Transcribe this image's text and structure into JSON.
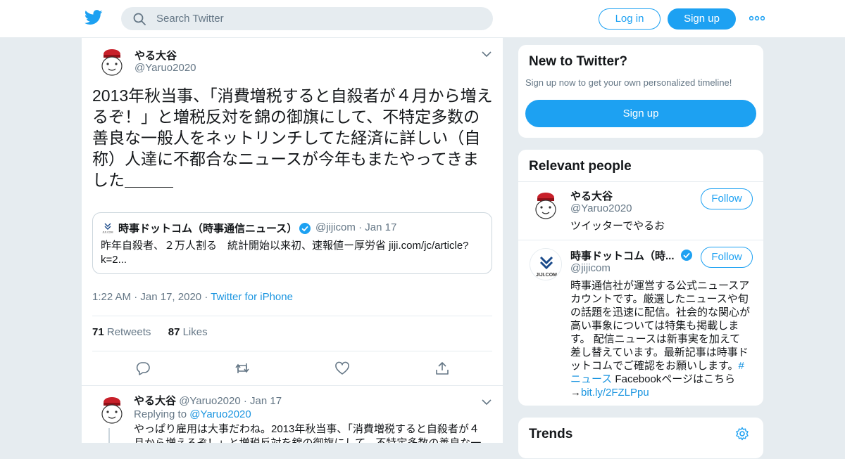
{
  "header": {
    "search_placeholder": "Search Twitter",
    "login_label": "Log in",
    "signup_label": "Sign up"
  },
  "tweet": {
    "author_name": "やる大谷",
    "author_handle": "@Yaruo2020",
    "text": "2013年秋当事、「消費増税すると自殺者が４月から増えるぞ！」と増税反対を錦の御旗にして、不特定多数の善良な一般人をネットリンチしてた経済に詳しい（自称）人達に不都合なニュースが今年もまたやってきました＿＿＿",
    "quote": {
      "avatar_text": "JIJI.COM",
      "name": "時事ドットコム（時事通信ニュース）",
      "handle": "@jijicom",
      "date": "Jan 17",
      "text": "昨年自殺者、２万人割る　統計開始以来初、速報値ー厚労省 jiji.com/jc/article?k=2..."
    },
    "time": "1:22 AM",
    "date": "Jan 17, 2020",
    "source": "Twitter for iPhone",
    "retweets_count": "71",
    "retweets_label": "Retweets",
    "likes_count": "87",
    "likes_label": "Likes"
  },
  "reply": {
    "author_name": "やる大谷",
    "author_handle": "@Yaruo2020",
    "date": "Jan 17",
    "replying_to_label": "Replying to",
    "replying_to_handle": "@Yaruo2020",
    "text_line1": "やっぱり雇用は大事だわね。2013年秋当事、「消費増税すると自殺者が４",
    "text_line2": "月から増えるぞ！」と増税反対を錦の御旗にして、不特定多数の善良な一"
  },
  "new_to_twitter": {
    "title": "New to Twitter?",
    "subtitle": "Sign up now to get your own personalized timeline!",
    "button_label": "Sign up"
  },
  "relevant_people": {
    "title": "Relevant people",
    "follow_label": "Follow",
    "people": [
      {
        "name": "やる大谷",
        "handle": "@Yaruo2020",
        "bio": "ツイッターでやるお"
      },
      {
        "name": "時事ドットコム（時...",
        "handle": "@jijicom",
        "avatar_text": "JIJI.COM",
        "bio_lines": [
          "時事通信社が運営する公式ニュースア",
          "カウントです。厳選したニュースや旬",
          "の話題を迅速に配信。社会的な関心が",
          "高い事象については特集も掲載しま",
          "す。 配信ニュースは新事実を加えて",
          "差し替えています。最新記事は時事ド",
          "ットコムでご確認をお願いします。"
        ],
        "bio_hashtag_a": "#",
        "bio_hashtag_b": "ニュース",
        "bio_tail": " Facebookページはこちら",
        "bio_arrow": "→",
        "bio_link": "bit.ly/2FZLPpu"
      }
    ]
  },
  "trends": {
    "title": "Trends"
  },
  "colors": {
    "accent": "#1da1f2",
    "link": "#1b95e0",
    "verified": "#1da1f2",
    "background": "#e6ecf0"
  },
  "icons": [
    "twitter-bird-icon",
    "search-icon",
    "more-dots-icon",
    "chevron-down-icon",
    "verified-badge-icon",
    "reply-icon",
    "retweet-icon",
    "like-icon",
    "share-icon",
    "settings-gear-icon"
  ]
}
